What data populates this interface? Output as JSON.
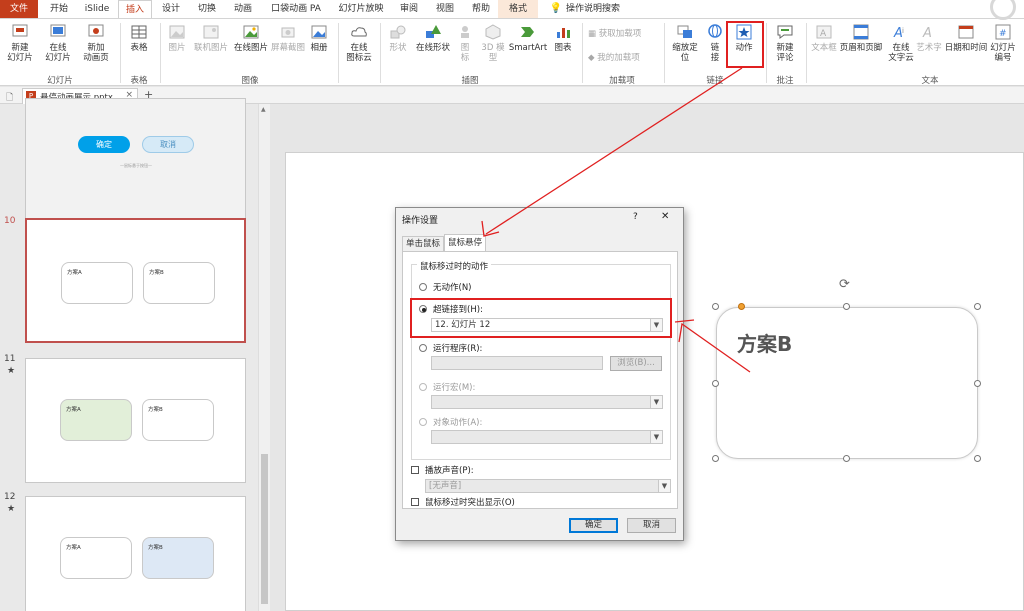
{
  "tabs": [
    "文件",
    "开始",
    "iSlide",
    "插入",
    "设计",
    "切换",
    "动画",
    "口袋动画 PA",
    "幻灯片放映",
    "审阅",
    "视图",
    "帮助",
    "格式",
    "操作说明搜索"
  ],
  "ribbon": {
    "groups": {
      "slides": "幻灯片",
      "tables": "表格",
      "images": "图像",
      "illustrations": "插图",
      "addins": "加载项",
      "links": "链接",
      "comments": "批注",
      "text": "文本"
    },
    "buttons": {
      "new_slide": "新建\n幻灯片",
      "online_slide": "在线\n幻灯片",
      "new_anim_page": "新加\n动画页",
      "table": "表格",
      "picture": "图片",
      "online_pic": "联机图片",
      "online_pic2": "在线图片",
      "screenshot": "屏幕截图",
      "album": "相册",
      "online_icons": "在线\n图标云",
      "shapes": "形状",
      "online_shapes": "在线形状",
      "icons": "图\n标",
      "model3d": "3D 模\n型",
      "smartart": "SmartArt",
      "chart": "图表",
      "get_addins": "获取加载项",
      "my_addins": "我的加载项",
      "zoom": "缩放定\n位",
      "link": "链\n接",
      "action": "动作",
      "new_comment": "新建\n评论",
      "textbox": "文本框",
      "header_footer": "页眉和页脚",
      "online_text": "在线\n文字云",
      "wordart": "艺术字",
      "datetime": "日期和时间",
      "slide_number": "幻灯片\n编号"
    }
  },
  "document_tab": "悬停动画展示.pptx",
  "thumbnails": {
    "top_confirm": "确定",
    "top_cancel": "取消",
    "top_hint": "—鼠标悬于按钮—",
    "slides": [
      {
        "num": "10",
        "star": "",
        "a": "方案A",
        "b": "方案B"
      },
      {
        "num": "11",
        "star": "★",
        "a": "方案A",
        "b": "方案B"
      },
      {
        "num": "12",
        "star": "★",
        "a": "方案A",
        "b": "方案B"
      }
    ]
  },
  "slide_canvas": {
    "box_label": "方案B"
  },
  "dialog": {
    "title": "操作设置",
    "help": "?",
    "close": "✕",
    "tabs": [
      "单击鼠标",
      "鼠标悬停"
    ],
    "section": "鼠标移过时的动作",
    "options": {
      "none": "无动作(N)",
      "hyperlink": "超链接到(H):",
      "hyperlink_value": "12. 幻灯片 12",
      "run_program": "运行程序(R):",
      "browse": "浏览(B)...",
      "run_macro": "运行宏(M):",
      "object_action": "对象动作(A):"
    },
    "play_sound": "播放声音(P):",
    "sound_value": "[无声音]",
    "highlight": "鼠标移过时突出显示(O)",
    "ok": "确定",
    "cancel": "取消"
  },
  "colors": {
    "accent": "#c43e1c",
    "annotation": "#e02020",
    "thumb_green": "#e2efd9",
    "thumb_blue": "#dde8f5",
    "btn_blue": "#00a0e9"
  }
}
